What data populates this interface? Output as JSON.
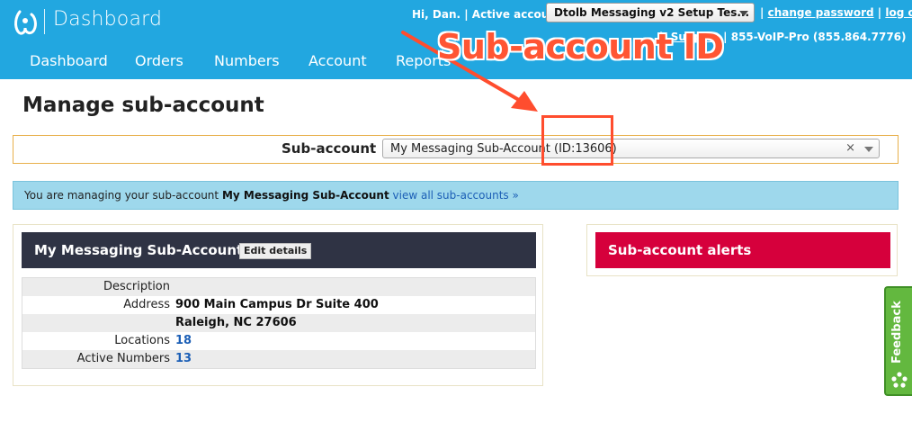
{
  "header": {
    "app_title": "Dashboard",
    "greeting": "Hi, Dan. | Active account:",
    "active_account": "Dtolb Messaging v2 Setup Tes...",
    "change_password": "change password",
    "logout": "log out",
    "separator": "|",
    "support_link": "h Support",
    "support_phone": "| 855-VoIP-Pro (855.864.7776)"
  },
  "nav": {
    "items": [
      "Dashboard",
      "Orders",
      "Numbers",
      "Account",
      "Reports"
    ]
  },
  "annotation": {
    "label": "Sub-account ID"
  },
  "page": {
    "title": "Manage sub-account",
    "subaccount_label": "Sub-account",
    "subaccount_value": "My Messaging Sub-Account (ID:13606)",
    "clear_symbol": "×"
  },
  "info_bar": {
    "prefix": "You are managing your sub-account ",
    "account_name": "My Messaging Sub-Account",
    "view_all": " view all sub-accounts »"
  },
  "details_panel": {
    "title": "My Messaging Sub-Account",
    "edit_button": "Edit details",
    "rows": [
      {
        "label": "Description",
        "value": ""
      },
      {
        "label": "Address",
        "value": "900 Main Campus Dr Suite 400"
      },
      {
        "label": "",
        "value": "Raleigh, NC 27606"
      },
      {
        "label": "Locations",
        "value": "18"
      },
      {
        "label": "Active Numbers",
        "value": "13"
      }
    ]
  },
  "alerts_panel": {
    "title": "Sub-account alerts"
  },
  "feedback": {
    "label": "Feedback"
  },
  "colors": {
    "header_blue": "#22a7e0",
    "annotation_red": "#ff4d2e",
    "panel_dark": "#2f3344",
    "alerts_red": "#d6003c",
    "feedback_green": "#63b83f",
    "info_blue": "#9ed8ec"
  }
}
